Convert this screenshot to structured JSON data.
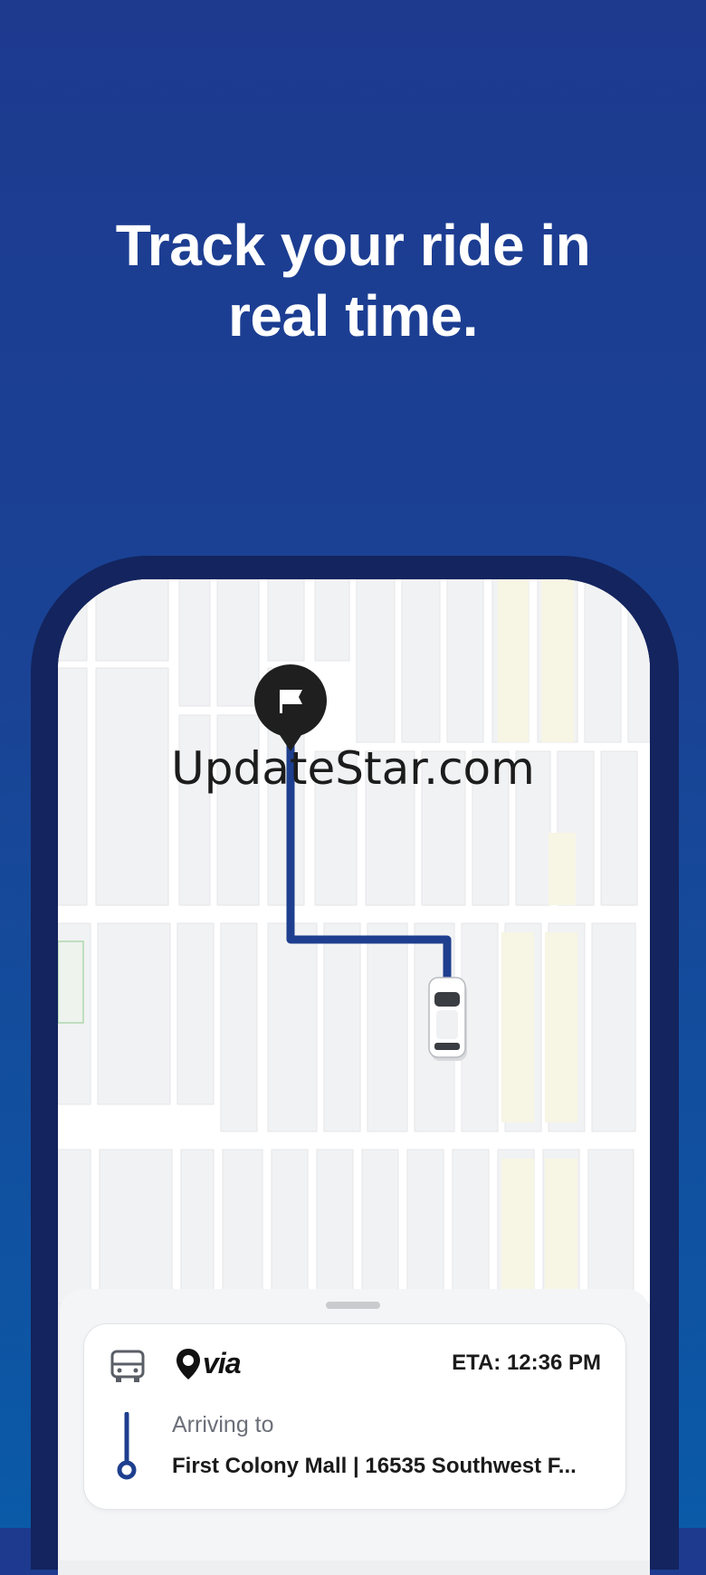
{
  "headline": "Track your ride in\nreal time.",
  "watermark": "UpdateStar.com",
  "ride_card": {
    "brand": "via",
    "eta": "ETA: 12:36 PM",
    "arriving_label": "Arriving to",
    "destination": "First Colony Mall | 16535 Southwest F..."
  },
  "icons": {
    "destination_pin": "flag-pin-icon",
    "vehicle": "car-icon",
    "bus": "bus-icon",
    "route": "route-line-icon"
  },
  "colors": {
    "background_top": "#1d3a8f",
    "background_bottom": "#0a5aa8",
    "phone_frame": "#13245e",
    "route": "#1e3f8f",
    "map_block": "#f1f2f3",
    "map_road": "#ffffff",
    "map_park": "#f7f5e4"
  }
}
